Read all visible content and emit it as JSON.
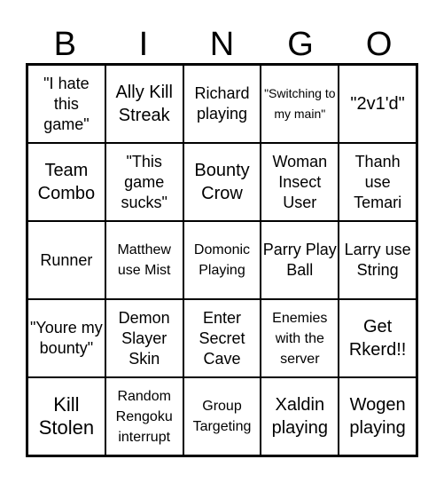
{
  "header": {
    "letters": [
      "B",
      "I",
      "N",
      "G",
      "O"
    ]
  },
  "cells": [
    [
      "\"I hate this game\"",
      "Ally Kill Streak",
      "Richard playing",
      "\"Switching to my main\"",
      "\"2v1'd\""
    ],
    [
      "Team Combo",
      "\"This game sucks\"",
      "Bounty Crow",
      "Woman Insect User",
      "Thanh use Temari"
    ],
    [
      "Runner",
      "Matthew use Mist",
      "Domonic Playing",
      "Parry Play Ball",
      "Larry use String"
    ],
    [
      "\"Youre my bounty\"",
      "Demon Slayer Skin",
      "Enter Secret Cave",
      "Enemies with the server",
      "Get Rkerd!!"
    ],
    [
      "Kill Stolen",
      "Random Rengoku interrupt",
      "Group Targeting",
      "Xaldin playing",
      "Wogen playing"
    ]
  ]
}
